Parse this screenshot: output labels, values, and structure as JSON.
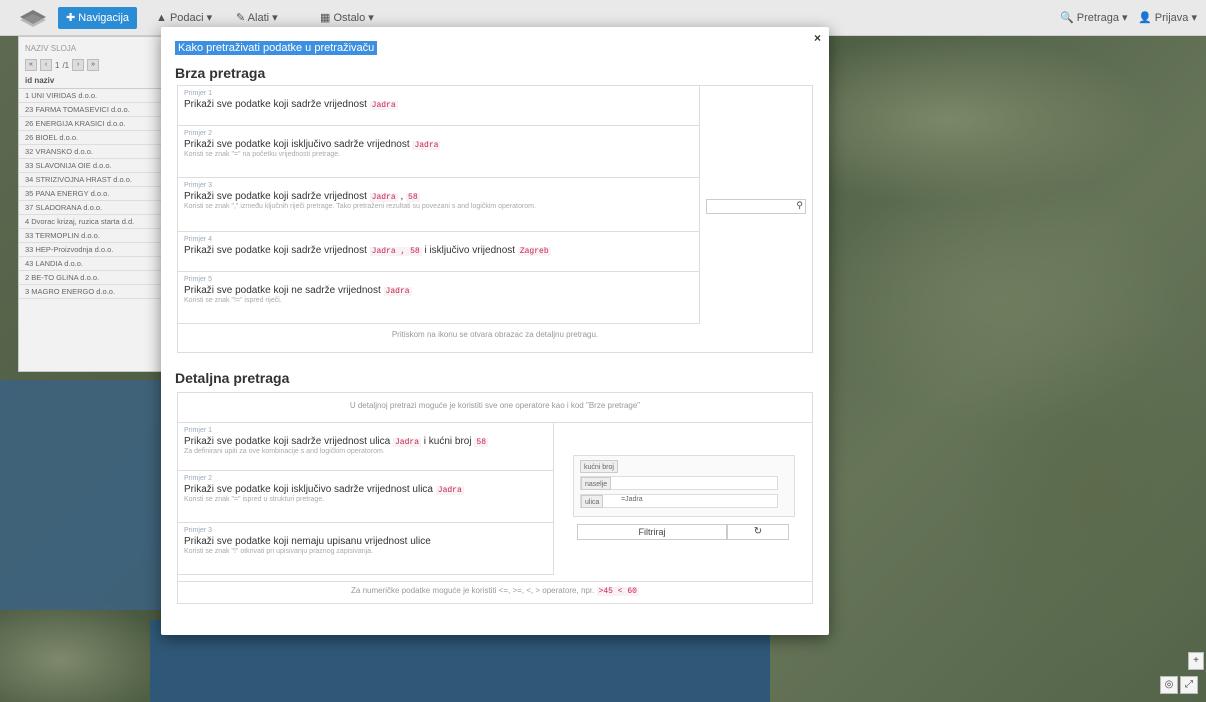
{
  "navbar": {
    "nav_label": "Navigacija",
    "menu_1": "Podaci",
    "menu_2": "Alati",
    "menu_3": "Ostalo",
    "search_label": "Pretraga",
    "user_label": "Prijava"
  },
  "panel": {
    "title": "NAZIV SLOJA",
    "page_text": "/1",
    "page_current": "1",
    "column_id": "id",
    "column_name": "naziv",
    "rows": [
      "UNI VIRIDAS d.o.o.",
      "FARMA TOMASEVICI d.o.o.",
      "ENERGIJA KRASICI d.o.o.",
      "BIOEL d.o.o.",
      "VRANSKO d.o.o.",
      "SLAVONIJA OIE d.o.o.",
      "STRIZIVOJNA HRAST d.o.o.",
      "PANA ENERGY d.o.o.",
      "SLADORANA d.o.o.",
      "Dvorac krizaj, ruzica starta d.d.",
      "TERMOPLIN d.o.o.",
      "HEP-Proizvodnja d.o.o.",
      "LANDIA d.o.o.",
      "BE-TO GLINA d.o.o.",
      "MAGRO ENERGO d.o.o."
    ],
    "row_ids": [
      "1",
      "23",
      "26",
      "26",
      "32",
      "33",
      "34",
      "35",
      "37",
      "4",
      "33",
      "33",
      "43",
      "2",
      "3"
    ]
  },
  "modal": {
    "top_link": "Kako pretraživati podatke u pretraživaču",
    "quick_title": "Brza pretraga",
    "quick_examples": [
      {
        "label": "Primjer 1",
        "main": "Prikaži sve podatke koji sadrže vrijednost",
        "code": "Jadra",
        "code2": "",
        "code3": "",
        "tail": "",
        "note": ""
      },
      {
        "label": "Primjer 2",
        "main": "Prikaži sve podatke koji isključivo sadrže vrijednost",
        "code": "Jadra",
        "code2": "",
        "code3": "",
        "tail": "",
        "note": "Koristi se znak \"=\" na početku vrijednosti pretrage."
      },
      {
        "label": "Primjer 3",
        "main": "Prikaži sve podatke koji sadrže vrijednost",
        "code": "Jadra",
        "code2": "58",
        "code3": "",
        "tail": "",
        "note": "Koristi se znak \",\" između ključnih riječi pretrage. Tako pretraženi rezultati su povezani s and logičkim operatorom."
      },
      {
        "label": "Primjer 4",
        "main": "Prikaži sve podatke koji sadrže vrijednost",
        "code": "Jadra , 58",
        "code2": "",
        "code3": "Zagreb",
        "tail": "i isključivo vrijednost",
        "note": ""
      },
      {
        "label": "Primjer 5",
        "main": "Prikaži sve podatke koji ne sadrže vrijednost",
        "code": "Jadra",
        "code2": "",
        "code3": "",
        "tail": "",
        "note": "Koristi se znak \"!=\" ispred riječi."
      }
    ],
    "quick_footer": "Pritiskom na ikonu se otvara obrazac za detaljnu pretragu.",
    "detail_title": "Detaljna pretraga",
    "detail_header": "U detaljnoj pretrazi moguće je koristiti sve one operatore kao i kod \"Brze pretrage\"",
    "detail_examples": [
      {
        "label": "Primjer 1",
        "main": "Prikaži sve podatke koji sadrže vrijednost ulica",
        "code": "Jadra",
        "mid": "i kućni broj",
        "code2": "58",
        "note": "Za definirani upiti za ove kombinacije s and logičkim operatorom."
      },
      {
        "label": "Primjer 2",
        "main": "Prikaži sve podatke koji isključivo sadrže vrijednost ulica",
        "code": "Jadra",
        "mid": "",
        "code2": "",
        "note": "Koristi se znak \"=\" ispred u strukturi pretrage."
      },
      {
        "label": "Primjer 3",
        "main": "Prikaži sve podatke koji nemaju upisanu vrijednost ulice",
        "code": "",
        "mid": "",
        "code2": "",
        "note": "Koristi se znak \"!\" otkrivati pri upisivanju praznog zapisivanja."
      }
    ],
    "filter_tags": [
      "kućni broj",
      "naselje",
      "ulica"
    ],
    "filter_value": "=Jadra",
    "filter_button": "Filtriraj",
    "reset_icon": "↻",
    "detail_footer": "Za numeričke podatke moguće je koristiti <=, >=, <, > operatore, npr.",
    "detail_footer_code": ">45 < 60"
  },
  "icons": {
    "close": "×",
    "search": "🔍"
  }
}
